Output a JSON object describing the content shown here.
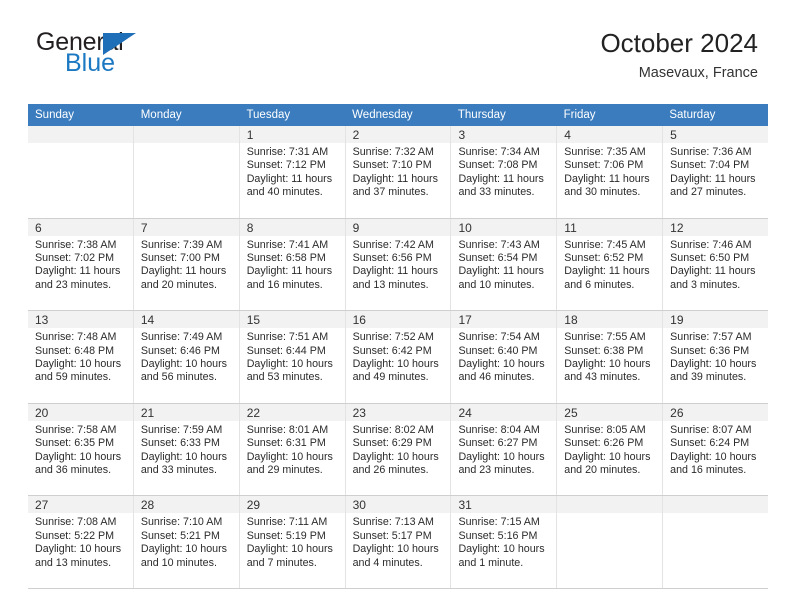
{
  "brand": {
    "name_part1": "General",
    "name_part2": "Blue",
    "triangle_color": "#1f6fb8"
  },
  "header": {
    "title": "October 2024",
    "location": "Masevaux, France"
  },
  "theme": {
    "header_row_bg": "#3a7cbe",
    "daynum_band_bg": "#f2f2f2",
    "grid_line": "#cfcfcf",
    "text": "#222222"
  },
  "weekday_headers": [
    "Sunday",
    "Monday",
    "Tuesday",
    "Wednesday",
    "Thursday",
    "Friday",
    "Saturday"
  ],
  "weeks": [
    [
      {
        "day": "",
        "sunrise": "",
        "sunset": "",
        "daylight": "",
        "empty": true
      },
      {
        "day": "",
        "sunrise": "",
        "sunset": "",
        "daylight": "",
        "empty": true
      },
      {
        "day": "1",
        "sunrise": "Sunrise: 7:31 AM",
        "sunset": "Sunset: 7:12 PM",
        "daylight": "Daylight: 11 hours and 40 minutes."
      },
      {
        "day": "2",
        "sunrise": "Sunrise: 7:32 AM",
        "sunset": "Sunset: 7:10 PM",
        "daylight": "Daylight: 11 hours and 37 minutes."
      },
      {
        "day": "3",
        "sunrise": "Sunrise: 7:34 AM",
        "sunset": "Sunset: 7:08 PM",
        "daylight": "Daylight: 11 hours and 33 minutes."
      },
      {
        "day": "4",
        "sunrise": "Sunrise: 7:35 AM",
        "sunset": "Sunset: 7:06 PM",
        "daylight": "Daylight: 11 hours and 30 minutes."
      },
      {
        "day": "5",
        "sunrise": "Sunrise: 7:36 AM",
        "sunset": "Sunset: 7:04 PM",
        "daylight": "Daylight: 11 hours and 27 minutes."
      }
    ],
    [
      {
        "day": "6",
        "sunrise": "Sunrise: 7:38 AM",
        "sunset": "Sunset: 7:02 PM",
        "daylight": "Daylight: 11 hours and 23 minutes."
      },
      {
        "day": "7",
        "sunrise": "Sunrise: 7:39 AM",
        "sunset": "Sunset: 7:00 PM",
        "daylight": "Daylight: 11 hours and 20 minutes."
      },
      {
        "day": "8",
        "sunrise": "Sunrise: 7:41 AM",
        "sunset": "Sunset: 6:58 PM",
        "daylight": "Daylight: 11 hours and 16 minutes."
      },
      {
        "day": "9",
        "sunrise": "Sunrise: 7:42 AM",
        "sunset": "Sunset: 6:56 PM",
        "daylight": "Daylight: 11 hours and 13 minutes."
      },
      {
        "day": "10",
        "sunrise": "Sunrise: 7:43 AM",
        "sunset": "Sunset: 6:54 PM",
        "daylight": "Daylight: 11 hours and 10 minutes."
      },
      {
        "day": "11",
        "sunrise": "Sunrise: 7:45 AM",
        "sunset": "Sunset: 6:52 PM",
        "daylight": "Daylight: 11 hours and 6 minutes."
      },
      {
        "day": "12",
        "sunrise": "Sunrise: 7:46 AM",
        "sunset": "Sunset: 6:50 PM",
        "daylight": "Daylight: 11 hours and 3 minutes."
      }
    ],
    [
      {
        "day": "13",
        "sunrise": "Sunrise: 7:48 AM",
        "sunset": "Sunset: 6:48 PM",
        "daylight": "Daylight: 10 hours and 59 minutes."
      },
      {
        "day": "14",
        "sunrise": "Sunrise: 7:49 AM",
        "sunset": "Sunset: 6:46 PM",
        "daylight": "Daylight: 10 hours and 56 minutes."
      },
      {
        "day": "15",
        "sunrise": "Sunrise: 7:51 AM",
        "sunset": "Sunset: 6:44 PM",
        "daylight": "Daylight: 10 hours and 53 minutes."
      },
      {
        "day": "16",
        "sunrise": "Sunrise: 7:52 AM",
        "sunset": "Sunset: 6:42 PM",
        "daylight": "Daylight: 10 hours and 49 minutes."
      },
      {
        "day": "17",
        "sunrise": "Sunrise: 7:54 AM",
        "sunset": "Sunset: 6:40 PM",
        "daylight": "Daylight: 10 hours and 46 minutes."
      },
      {
        "day": "18",
        "sunrise": "Sunrise: 7:55 AM",
        "sunset": "Sunset: 6:38 PM",
        "daylight": "Daylight: 10 hours and 43 minutes."
      },
      {
        "day": "19",
        "sunrise": "Sunrise: 7:57 AM",
        "sunset": "Sunset: 6:36 PM",
        "daylight": "Daylight: 10 hours and 39 minutes."
      }
    ],
    [
      {
        "day": "20",
        "sunrise": "Sunrise: 7:58 AM",
        "sunset": "Sunset: 6:35 PM",
        "daylight": "Daylight: 10 hours and 36 minutes."
      },
      {
        "day": "21",
        "sunrise": "Sunrise: 7:59 AM",
        "sunset": "Sunset: 6:33 PM",
        "daylight": "Daylight: 10 hours and 33 minutes."
      },
      {
        "day": "22",
        "sunrise": "Sunrise: 8:01 AM",
        "sunset": "Sunset: 6:31 PM",
        "daylight": "Daylight: 10 hours and 29 minutes."
      },
      {
        "day": "23",
        "sunrise": "Sunrise: 8:02 AM",
        "sunset": "Sunset: 6:29 PM",
        "daylight": "Daylight: 10 hours and 26 minutes."
      },
      {
        "day": "24",
        "sunrise": "Sunrise: 8:04 AM",
        "sunset": "Sunset: 6:27 PM",
        "daylight": "Daylight: 10 hours and 23 minutes."
      },
      {
        "day": "25",
        "sunrise": "Sunrise: 8:05 AM",
        "sunset": "Sunset: 6:26 PM",
        "daylight": "Daylight: 10 hours and 20 minutes."
      },
      {
        "day": "26",
        "sunrise": "Sunrise: 8:07 AM",
        "sunset": "Sunset: 6:24 PM",
        "daylight": "Daylight: 10 hours and 16 minutes."
      }
    ],
    [
      {
        "day": "27",
        "sunrise": "Sunrise: 7:08 AM",
        "sunset": "Sunset: 5:22 PM",
        "daylight": "Daylight: 10 hours and 13 minutes."
      },
      {
        "day": "28",
        "sunrise": "Sunrise: 7:10 AM",
        "sunset": "Sunset: 5:21 PM",
        "daylight": "Daylight: 10 hours and 10 minutes."
      },
      {
        "day": "29",
        "sunrise": "Sunrise: 7:11 AM",
        "sunset": "Sunset: 5:19 PM",
        "daylight": "Daylight: 10 hours and 7 minutes."
      },
      {
        "day": "30",
        "sunrise": "Sunrise: 7:13 AM",
        "sunset": "Sunset: 5:17 PM",
        "daylight": "Daylight: 10 hours and 4 minutes."
      },
      {
        "day": "31",
        "sunrise": "Sunrise: 7:15 AM",
        "sunset": "Sunset: 5:16 PM",
        "daylight": "Daylight: 10 hours and 1 minute."
      },
      {
        "day": "",
        "sunrise": "",
        "sunset": "",
        "daylight": "",
        "empty": true
      },
      {
        "day": "",
        "sunrise": "",
        "sunset": "",
        "daylight": "",
        "empty": true
      }
    ]
  ]
}
